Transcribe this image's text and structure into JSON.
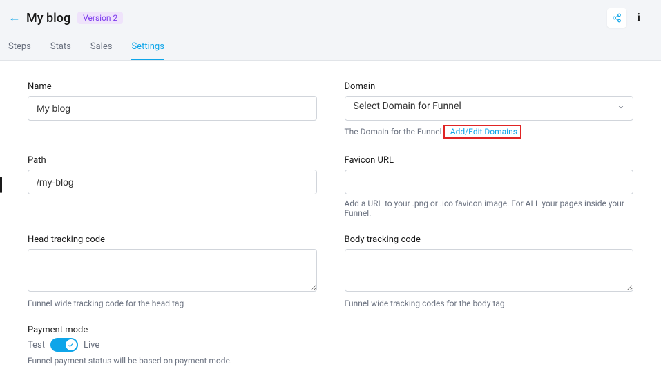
{
  "header": {
    "title": "My blog",
    "version_badge": "Version 2",
    "share_icon": "share-icon",
    "info_icon": "info-icon"
  },
  "tabs": [
    {
      "label": "Steps",
      "active": false
    },
    {
      "label": "Stats",
      "active": false
    },
    {
      "label": "Sales",
      "active": false
    },
    {
      "label": "Settings",
      "active": true
    }
  ],
  "fields": {
    "name": {
      "label": "Name",
      "value": "My blog"
    },
    "domain": {
      "label": "Domain",
      "selected": "Select Domain for Funnel",
      "help_prefix": "The Domain for the Funnel",
      "link_text": "-Add/Edit Domains"
    },
    "path": {
      "label": "Path",
      "value": "/my-blog"
    },
    "favicon": {
      "label": "Favicon URL",
      "value": "",
      "help": "Add a URL to your .png or .ico favicon image. For ALL your pages inside your Funnel."
    },
    "head_tracking": {
      "label": "Head tracking code",
      "value": "",
      "help": "Funnel wide tracking code for the head tag"
    },
    "body_tracking": {
      "label": "Body tracking code",
      "value": "",
      "help": "Funnel wide tracking codes for the body tag"
    },
    "payment_mode": {
      "label": "Payment mode",
      "left": "Test",
      "right": "Live",
      "help": "Funnel payment status will be based on payment mode."
    }
  }
}
